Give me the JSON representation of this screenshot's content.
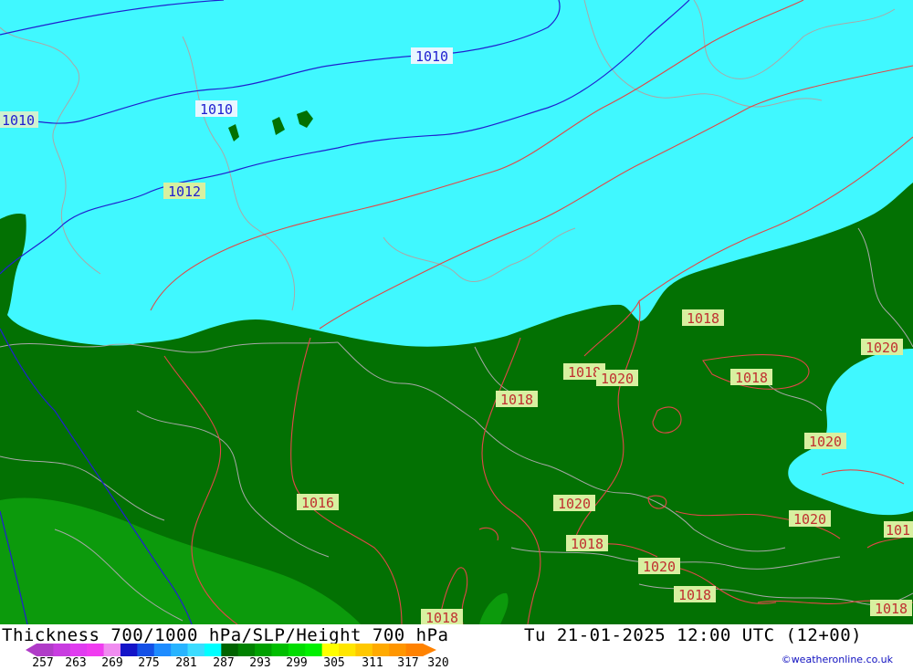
{
  "title": {
    "left": "Thickness 700/1000 hPa/SLP/Height 700 hPa",
    "right": "Tu 21-01-2025 12:00 UTC (12+00)"
  },
  "credit": "©weatheronline.co.uk",
  "legend": {
    "ticks": [
      "257",
      "263",
      "269",
      "275",
      "281",
      "287",
      "293",
      "299",
      "305",
      "311",
      "317",
      "320"
    ],
    "colors": [
      "#b03cc8",
      "#c83ce0",
      "#e03cf0",
      "#f03cf0",
      "#f08cf0",
      "#1414c8",
      "#1450e6",
      "#1e8cff",
      "#28b4ff",
      "#3cdcff",
      "#00ffff",
      "#006400",
      "#008200",
      "#00a000",
      "#00be00",
      "#00dc00",
      "#00f000",
      "#ffff00",
      "#ffe600",
      "#ffc800",
      "#ffaa00",
      "#ff9600",
      "#ff8200"
    ]
  },
  "colors": {
    "sea_cold": "#40f8ff",
    "land_green": "#037103",
    "land_green_light": "#0c9a0c",
    "isobar_blue": "#2020d0",
    "isobar_red": "#e04040",
    "coast": "#a0a0a0"
  },
  "isobar_labels": [
    {
      "id": "lbl-1010-a",
      "text": "1010",
      "color": "blue"
    },
    {
      "id": "lbl-1010-b",
      "text": "1010",
      "color": "blue"
    },
    {
      "id": "lbl-1010-c",
      "text": "1010",
      "color": "blue"
    },
    {
      "id": "lbl-1012",
      "text": "1012",
      "color": "blue"
    },
    {
      "id": "lbl-1016",
      "text": "1016",
      "color": "red"
    },
    {
      "id": "lbl-1018-a",
      "text": "1018",
      "color": "red"
    },
    {
      "id": "lbl-1018-b",
      "text": "1018",
      "color": "red"
    },
    {
      "id": "lbl-1018-c",
      "text": "1018",
      "color": "red"
    },
    {
      "id": "lbl-1018-d",
      "text": "1018",
      "color": "red"
    },
    {
      "id": "lbl-1018-e",
      "text": "1018",
      "color": "red"
    },
    {
      "id": "lbl-1018-f",
      "text": "1018",
      "color": "red"
    },
    {
      "id": "lbl-1018-g",
      "text": "1018",
      "color": "red"
    },
    {
      "id": "lbl-1018-h",
      "text": "1018",
      "color": "red"
    },
    {
      "id": "lbl-1020-a",
      "text": "1020",
      "color": "red"
    },
    {
      "id": "lbl-1020-b",
      "text": "1020",
      "color": "red"
    },
    {
      "id": "lbl-1020-c",
      "text": "1020",
      "color": "red"
    },
    {
      "id": "lbl-1020-d",
      "text": "1020",
      "color": "red"
    },
    {
      "id": "lbl-1020-e",
      "text": "1020",
      "color": "red"
    },
    {
      "id": "lbl-1020-f",
      "text": "1020",
      "color": "red"
    },
    {
      "id": "lbl-101",
      "text": "101",
      "color": "red"
    }
  ]
}
